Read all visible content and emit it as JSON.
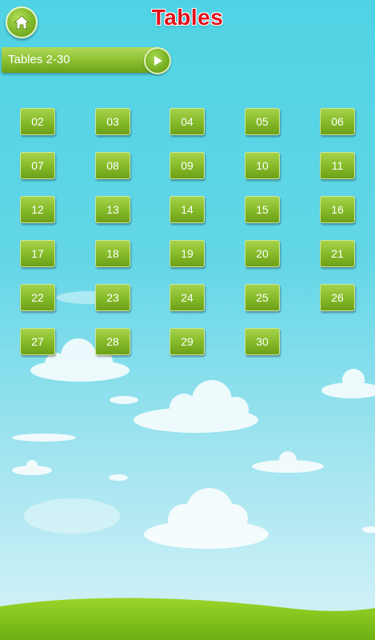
{
  "header": {
    "title": "Tables",
    "home_icon": "home-icon"
  },
  "section": {
    "label": "Tables 2-30",
    "play_icon": "play-icon"
  },
  "tables": [
    "02",
    "03",
    "04",
    "05",
    "06",
    "07",
    "08",
    "09",
    "10",
    "11",
    "12",
    "13",
    "14",
    "15",
    "16",
    "17",
    "18",
    "19",
    "20",
    "21",
    "22",
    "23",
    "24",
    "25",
    "26",
    "27",
    "28",
    "29",
    "30"
  ],
  "colors": {
    "title": "#e4101b",
    "button_green": "#86bc2a",
    "sky": "#4fd3e4",
    "grass": "#7cc61c"
  }
}
